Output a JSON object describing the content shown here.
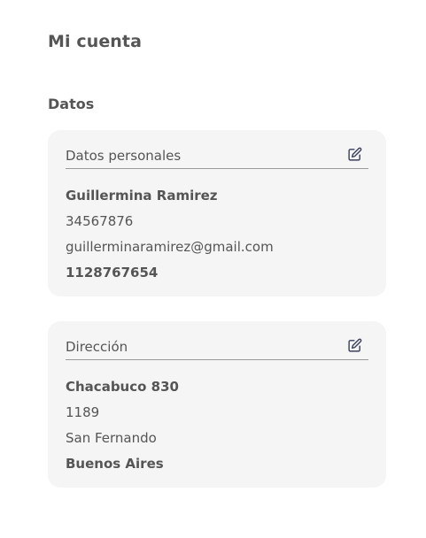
{
  "header": {
    "title": "Mi cuenta"
  },
  "section": {
    "title": "Datos"
  },
  "personal": {
    "title": "Datos personales",
    "edit_icon": "edit-icon",
    "name": "Guillermina Ramirez",
    "document": "34567876",
    "email": "guillerminaramirez@gmail.com",
    "phone": "1128767654"
  },
  "address": {
    "title": "Dirección",
    "edit_icon": "edit-icon",
    "street": "Chacabuco 830",
    "postal_code": "1189",
    "city": "San Fernando",
    "province": "Buenos Aires"
  },
  "colors": {
    "card_background": "#f5f5f5",
    "text": "#555555",
    "icon": "#3a3f5c"
  }
}
